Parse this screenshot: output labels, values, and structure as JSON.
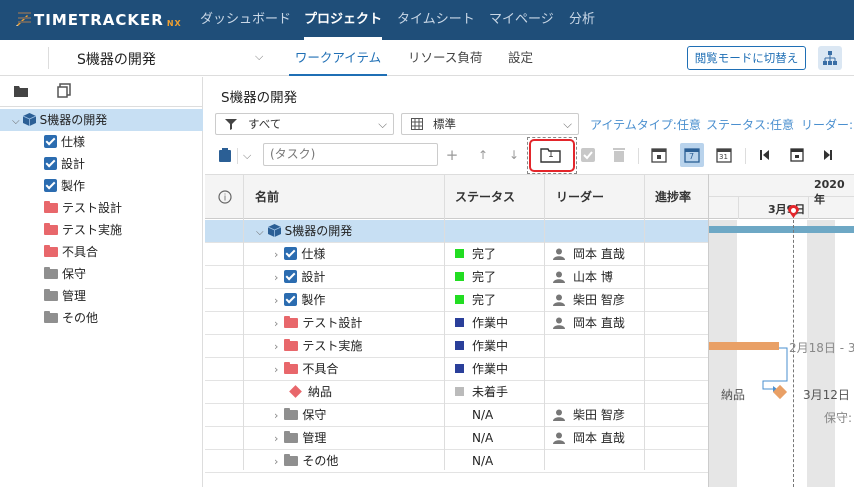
{
  "app": {
    "logo_text": "TIMETRACKER",
    "logo_suffix": "NX"
  },
  "topnav": [
    "ダッシュボード",
    "プロジェクト",
    "タイムシート",
    "マイページ",
    "分析"
  ],
  "subbar": {
    "project": "S機器の開発",
    "tabs": [
      "ワークアイテム",
      "リソース負荷",
      "設定"
    ],
    "view_mode_button": "閲覧モードに切替え"
  },
  "sidebar": {
    "tree": [
      {
        "label": "S機器の開発",
        "type": "project",
        "selected": true
      },
      {
        "label": "仕様",
        "type": "checked"
      },
      {
        "label": "設計",
        "type": "checked"
      },
      {
        "label": "製作",
        "type": "checked"
      },
      {
        "label": "テスト設計",
        "type": "red"
      },
      {
        "label": "テスト実施",
        "type": "red"
      },
      {
        "label": "不具合",
        "type": "red"
      },
      {
        "label": "保守",
        "type": "gray"
      },
      {
        "label": "管理",
        "type": "gray"
      },
      {
        "label": "その他",
        "type": "gray"
      }
    ]
  },
  "main": {
    "title": "S機器の開発",
    "filters": {
      "all": "すべて",
      "standard": "標準"
    },
    "filter_links": [
      "アイテムタイプ:任意",
      "ステータス:任意",
      "リーダー:"
    ],
    "task_placeholder": "(タスク)",
    "toolbar_glyphs": {
      "add": "+",
      "up": "↑",
      "down": "↓",
      "level": "1",
      "cal7": "7",
      "cal31": "31"
    },
    "columns": {
      "info": "i",
      "name": "名前",
      "status": "ステータス",
      "leader": "リーダー",
      "progress": "進捗率"
    },
    "rows": [
      {
        "name": "S機器の開発",
        "kind": "project",
        "status": "",
        "status_color": "",
        "leader": "",
        "selected": true
      },
      {
        "name": "仕様",
        "kind": "checked",
        "status": "完了",
        "status_color": "#22dd22",
        "leader": "岡本 直哉"
      },
      {
        "name": "設計",
        "kind": "checked",
        "status": "完了",
        "status_color": "#22dd22",
        "leader": "山本 博"
      },
      {
        "name": "製作",
        "kind": "checked",
        "status": "完了",
        "status_color": "#22dd22",
        "leader": "柴田 智彦"
      },
      {
        "name": "テスト設計",
        "kind": "red",
        "status": "作業中",
        "status_color": "#2a3f9a",
        "leader": "岡本 直哉"
      },
      {
        "name": "テスト実施",
        "kind": "red",
        "status": "作業中",
        "status_color": "#2a3f9a",
        "leader": ""
      },
      {
        "name": "不具合",
        "kind": "red",
        "status": "作業中",
        "status_color": "#2a3f9a",
        "leader": ""
      },
      {
        "name": "納品",
        "kind": "milestone",
        "status": "未着手",
        "status_color": "#bbbbbb",
        "leader": ""
      },
      {
        "name": "保守",
        "kind": "gray",
        "status": "N/A",
        "status_color": "",
        "leader": "柴田 智彦"
      },
      {
        "name": "管理",
        "kind": "gray",
        "status": "N/A",
        "status_color": "",
        "leader": "岡本 直哉"
      },
      {
        "name": "その他",
        "kind": "gray",
        "status": "N/A",
        "status_color": "",
        "leader": ""
      }
    ]
  },
  "gantt": {
    "year": "2020年",
    "date": "3月9日",
    "labels": {
      "test_exec": "2月18日 - 3",
      "delivery": "納品",
      "delivery_date": "3月12日",
      "maintenance": "保守:"
    }
  },
  "colors": {
    "header_bg": "#1f4e79",
    "accent": "#1f6fb5",
    "selection": "#c7dff3",
    "highlight_border": "#e3262b"
  }
}
